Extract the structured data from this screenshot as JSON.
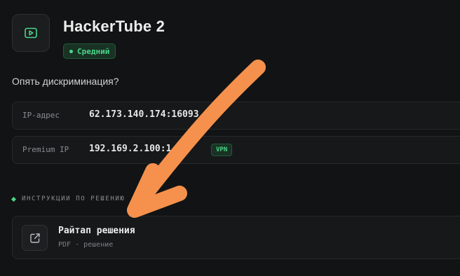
{
  "header": {
    "icon": "play-icon",
    "title": "HackerTube 2",
    "difficulty": "Средний"
  },
  "description": "Опять дискриминация?",
  "rows": [
    {
      "label": "IP-адрес",
      "value": "62.173.140.174:16093"
    },
    {
      "label": "Premium IP",
      "value": "192.169.2.100:1",
      "badge": "VPN"
    }
  ],
  "section": {
    "title": "ИНСТРУКЦИИ ПО РЕШЕНИЮ"
  },
  "writeup": {
    "icon": "external-link-icon",
    "title": "Райтап решения",
    "subtitle": "PDF · решение"
  },
  "annotation": {
    "icon": "arrow-down-left-icon",
    "color": "#f5914c"
  },
  "colors": {
    "accent": "#4cd689",
    "background": "#121314"
  }
}
